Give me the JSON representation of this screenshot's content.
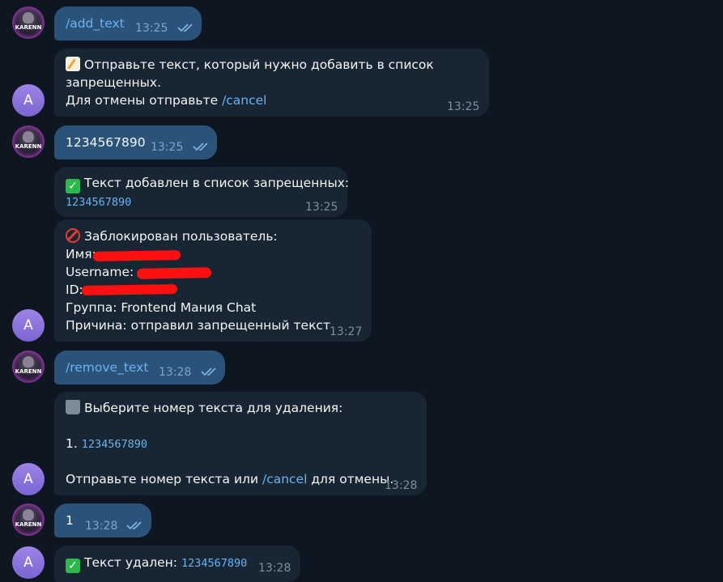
{
  "user": {
    "avatar_text": "KARENN"
  },
  "bot": {
    "avatar_letter": "A"
  },
  "messages": [
    {
      "text": "/add_text",
      "time": "13:25"
    },
    {
      "line1": "Отправьте текст, который нужно добавить в список",
      "line2": "запрещенных.",
      "line3_prefix": "Для отмены отправьте ",
      "line3_cmd": "/cancel",
      "time": "13:25"
    },
    {
      "text": "1234567890",
      "time": "13:25"
    },
    {
      "text": "Текст добавлен в список запрещенных:",
      "code": "1234567890",
      "time": "13:25"
    },
    {
      "title": "Заблокирован пользователь:",
      "name_label": "Имя:",
      "username_label": "Username:",
      "id_label": "ID:",
      "group": "Группа: Frontend Мания Chat",
      "reason": "Причина: отправил запрещенный текст",
      "time": "13:27"
    },
    {
      "text": "/remove_text",
      "time": "13:28"
    },
    {
      "title": "Выберите номер текста для удаления:",
      "item_num": "1. ",
      "item_code": "1234567890",
      "footer_prefix": "Отправьте номер текста или ",
      "footer_cmd": "/cancel",
      "footer_suffix": " для отмены.",
      "time": "13:28"
    },
    {
      "text": "1",
      "time": "13:28"
    },
    {
      "text": "Текст удален: ",
      "code": "1234567890",
      "time": "13:28"
    }
  ]
}
